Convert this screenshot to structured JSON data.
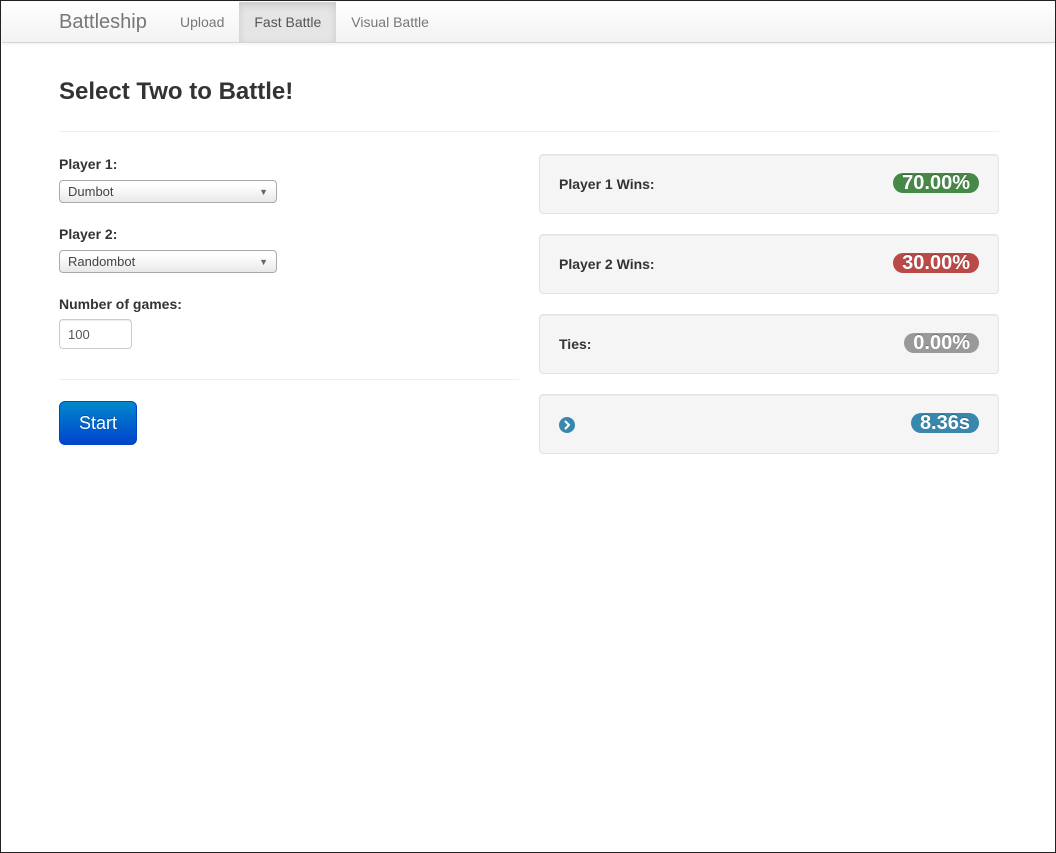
{
  "navbar": {
    "brand": "Battleship",
    "items": [
      {
        "label": "Upload",
        "active": false
      },
      {
        "label": "Fast Battle",
        "active": true
      },
      {
        "label": "Visual Battle",
        "active": false
      }
    ]
  },
  "page": {
    "title": "Select Two to Battle!"
  },
  "form": {
    "player1_label": "Player 1:",
    "player1_value": "Dumbot",
    "player2_label": "Player 2:",
    "player2_value": "Randombot",
    "games_label": "Number of games:",
    "games_value": "100",
    "start_label": "Start"
  },
  "results": {
    "player1_label": "Player 1 Wins:",
    "player1_value": "70.00%",
    "player2_label": "Player 2 Wins:",
    "player2_value": "30.00%",
    "ties_label": "Ties:",
    "ties_value": "0.00%",
    "time_value": "8.36s"
  },
  "colors": {
    "win": "#468847",
    "loss": "#b94a48",
    "tie": "#999999",
    "info": "#3a87ad",
    "primary": "#0044cc"
  },
  "icons": {
    "expand": "chevron-right-icon"
  }
}
